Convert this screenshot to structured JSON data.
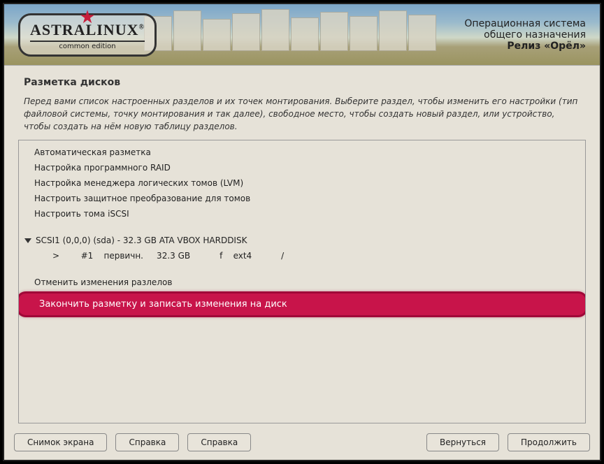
{
  "logo": {
    "main": "ASTRALINUX",
    "sub": "common edition",
    "registered": "®"
  },
  "header_text": {
    "line1": "Операционная система",
    "line2": "общего назначения",
    "line3": "Релиз «Орёл»"
  },
  "page_title": "Разметка дисков",
  "description": "Перед вами список настроенных разделов и их точек монтирования. Выберите раздел, чтобы изменить его настройки (тип файловой системы, точку монтирования и так далее), свободное место, чтобы создать новый раздел, или устройство, чтобы создать на нём новую таблицу разделов.",
  "menu_items": {
    "auto": "Автоматическая разметка",
    "raid": "Настройка программного RAID",
    "lvm": "Настройка менеджера логических томов (LVM)",
    "crypt": "Настроить защитное преобразование для томов",
    "iscsi": "Настроить тома iSCSI"
  },
  "disk": {
    "label": "SCSI1 (0,0,0) (sda) - 32.3 GB ATA VBOX HARDDISK",
    "partition": ">        #1    первичн.     32.3 GB           f    ext4           /"
  },
  "actions": {
    "undo": "Отменить изменения разлелов",
    "finish": "Закончить разметку и записать изменения на диск"
  },
  "buttons": {
    "screenshot": "Снимок экрана",
    "help1": "Справка",
    "help2": "Справка",
    "back": "Вернуться",
    "continue": "Продолжить"
  }
}
